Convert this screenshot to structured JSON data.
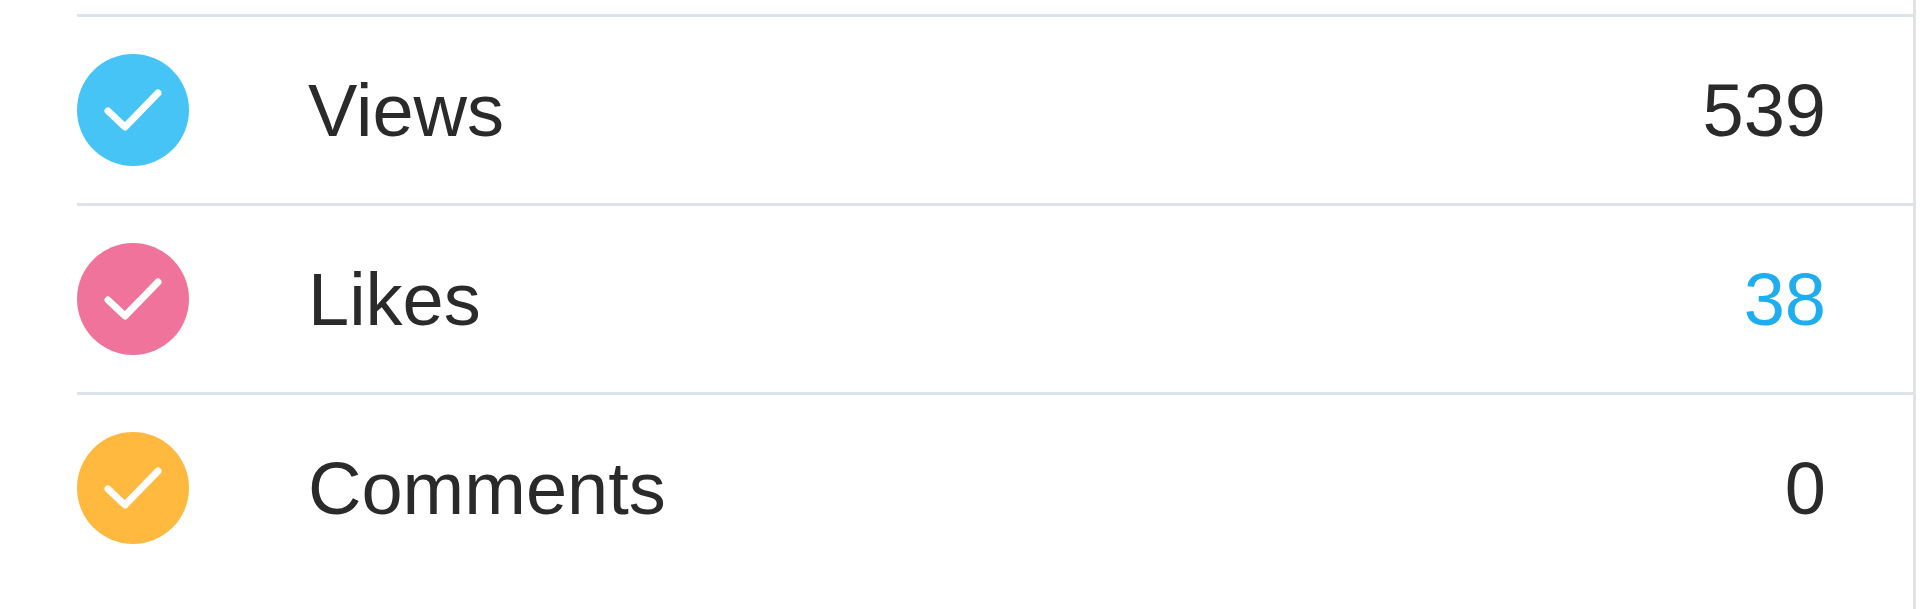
{
  "stats": [
    {
      "label": "Views",
      "value": "539",
      "checked": true,
      "color": "#45c4f5",
      "highlighted": false
    },
    {
      "label": "Likes",
      "value": "38",
      "checked": true,
      "color": "#f0739c",
      "highlighted": true
    },
    {
      "label": "Comments",
      "value": "0",
      "checked": true,
      "color": "#ffb93f",
      "highlighted": false
    }
  ]
}
